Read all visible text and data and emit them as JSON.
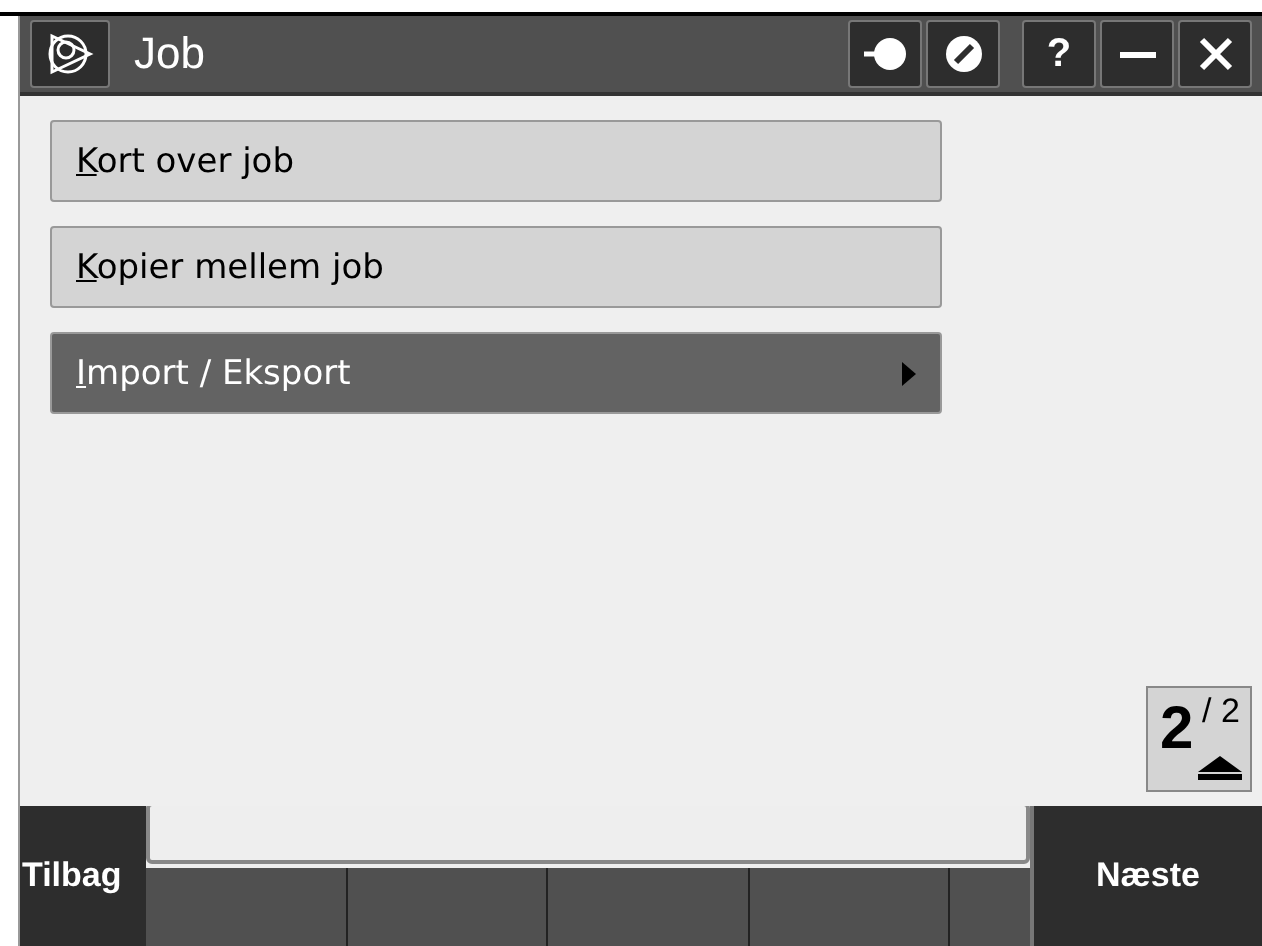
{
  "window": {
    "title": "Job"
  },
  "title_buttons": [
    {
      "kind": "login"
    },
    {
      "kind": "block"
    },
    {
      "kind": "help",
      "label": "?"
    },
    {
      "kind": "minimize"
    },
    {
      "kind": "close"
    }
  ],
  "menu_items": [
    {
      "label": "Kort over job",
      "selected": false,
      "submenu": false
    },
    {
      "label": "Kopier mellem job",
      "selected": false,
      "submenu": false
    },
    {
      "label": "Import / Eksport",
      "selected": true,
      "submenu": true
    }
  ],
  "page_indicator": {
    "current": "2",
    "total": "/ 2"
  },
  "softkeys": {
    "left": "Tilbag",
    "right": "Næste"
  }
}
